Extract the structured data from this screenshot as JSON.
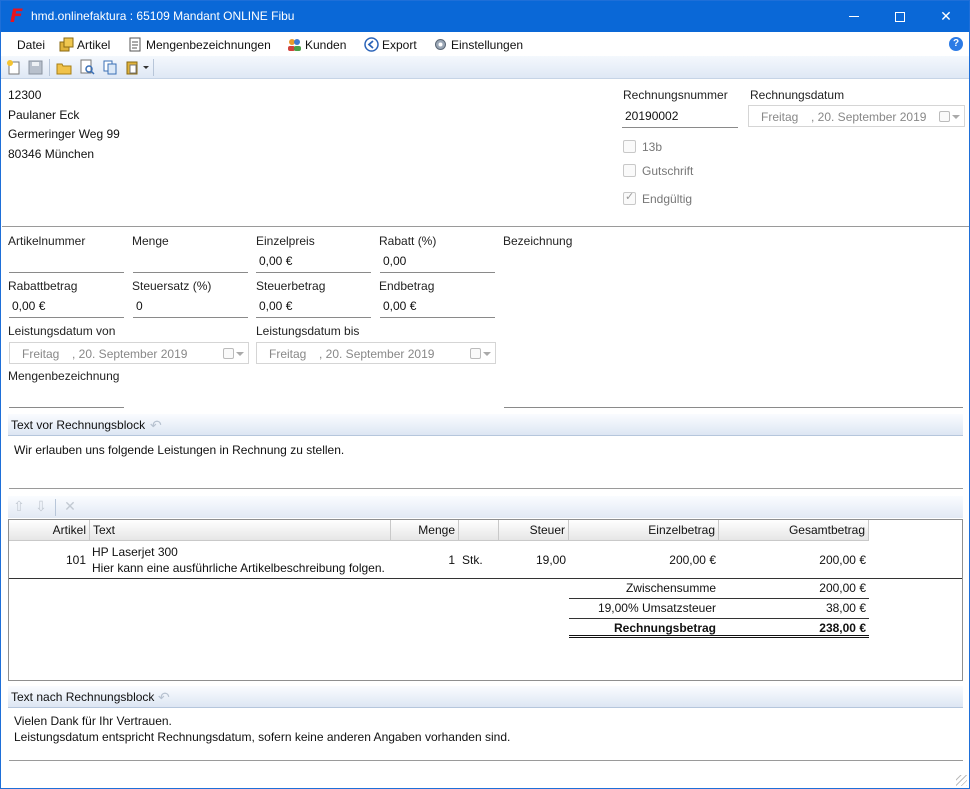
{
  "window": {
    "title": "hmd.onlinefaktura : 65109 Mandant ONLINE Fibu",
    "logo": "F"
  },
  "menu": [
    {
      "label": "Datei",
      "icon": ""
    },
    {
      "label": "Artikel",
      "icon": "boxes-icon"
    },
    {
      "label": "Mengenbezeichnungen",
      "icon": "document-icon"
    },
    {
      "label": "Kunden",
      "icon": "users-icon"
    },
    {
      "label": "Export",
      "icon": "arrow-left-circle-icon"
    },
    {
      "label": "Einstellungen",
      "icon": "gear-icon"
    }
  ],
  "customer": {
    "number": "12300",
    "name": "Paulaner Eck",
    "street": "Germeringer Weg 99",
    "city": "80346 München"
  },
  "invoice": {
    "number_label": "Rechnungsnummer",
    "number": "20190002",
    "date_label": "Rechnungsdatum",
    "date_dow": "Freitag",
    "date_value": ", 20. September 2019",
    "check_13b": "13b",
    "check_credit": "Gutschrift",
    "check_final": "Endgültig"
  },
  "position": {
    "article_no_label": "Artikelnummer",
    "article_no": "",
    "qty_label": "Menge",
    "qty": "",
    "unit_price_label": "Einzelpreis",
    "unit_price": "0,00 €",
    "discount_pct_label": "Rabatt (%)",
    "discount_pct": "0,00",
    "description_label": "Bezeichnung",
    "discount_amount_label": "Rabattbetrag",
    "discount_amount": "0,00 €",
    "tax_rate_label": "Steuersatz (%)",
    "tax_rate": "0",
    "tax_amount_label": "Steuerbetrag",
    "tax_amount": "0,00 €",
    "final_amount_label": "Endbetrag",
    "final_amount": "0,00 €",
    "service_from_label": "Leistungsdatum von",
    "service_from_dow": "Freitag",
    "service_from_date": ", 20. September 2019",
    "service_to_label": "Leistungsdatum bis",
    "service_to_dow": "Freitag",
    "service_to_date": ", 20. September 2019",
    "unit_label": "Mengenbezeichnung",
    "unit": ""
  },
  "text_before": {
    "label": "Text vor Rechnungsblock",
    "content": "Wir erlauben uns folgende Leistungen in Rechnung zu stellen."
  },
  "grid": {
    "headers": [
      "Artikel",
      "Text",
      "Menge",
      "",
      "Steuer",
      "Einzelbetrag",
      "Gesamtbetrag"
    ],
    "rows": [
      {
        "article": "101",
        "text_line1": "HP Laserjet 300",
        "text_line2": "Hier kann eine ausführliche Artikelbeschreibung folgen.",
        "qty": "1",
        "unit": "Stk.",
        "tax": "19,00",
        "unit_amount": "200,00 €",
        "total_amount": "200,00 €"
      }
    ],
    "subtotal_label": "Zwischensumme",
    "subtotal": "200,00 €",
    "vat_label": "19,00% Umsatzsteuer",
    "vat": "38,00 €",
    "grand_total_label": "Rechnungsbetrag",
    "grand_total": "238,00 €"
  },
  "text_after": {
    "label": "Text nach Rechnungsblock",
    "line1": "Vielen Dank für Ihr Vertrauen.",
    "line2": "Leistungsdatum entspricht Rechnungsdatum, sofern keine anderen Angaben vorhanden sind."
  }
}
